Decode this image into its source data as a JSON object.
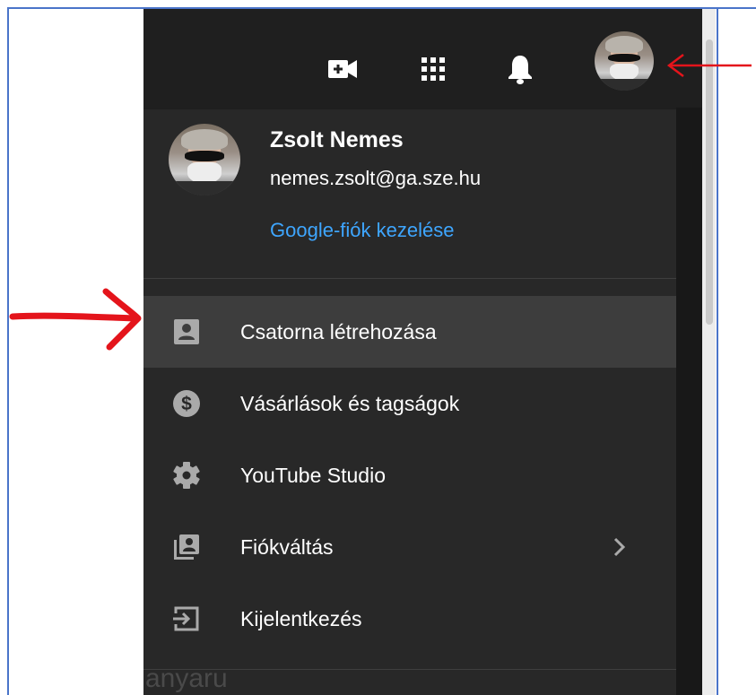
{
  "header": {
    "icons": [
      "create-video-icon",
      "apps-grid-icon",
      "notifications-bell-icon",
      "account-avatar"
    ]
  },
  "profile": {
    "name": "Zsolt Nemes",
    "email": "nemes.zsolt@ga.sze.hu",
    "manage_link": "Google-fiók kezelése"
  },
  "menu": {
    "items": [
      {
        "label": "Csatorna létrehozása",
        "icon": "account-box-icon",
        "highlighted": true
      },
      {
        "label": "Vásárlások és tagságok",
        "icon": "dollar-circle-icon"
      },
      {
        "label": "YouTube Studio",
        "icon": "gear-icon"
      },
      {
        "label": "Fiókváltás",
        "icon": "switch-account-icon",
        "has_submenu": true
      },
      {
        "label": "Kijelentkezés",
        "icon": "sign-out-icon"
      }
    ]
  },
  "background_text": "anyaru",
  "colors": {
    "panel": "#282828",
    "highlight": "#3d3d3d",
    "link": "#3ea6ff",
    "annotation_arrow": "#e4141b",
    "frame": "#4a74c9"
  }
}
